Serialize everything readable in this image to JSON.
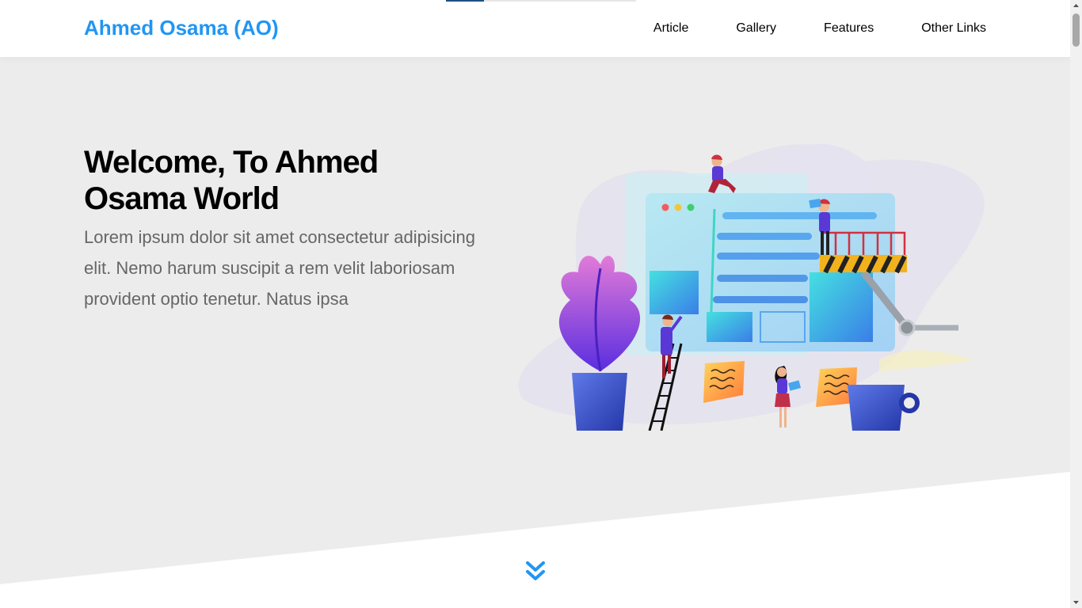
{
  "header": {
    "logo": "Ahmed Osama (AO)",
    "nav": [
      {
        "label": "Article"
      },
      {
        "label": "Gallery"
      },
      {
        "label": "Features"
      },
      {
        "label": "Other Links"
      }
    ],
    "scroll_progress": 0.2
  },
  "landing": {
    "title": "Welcome, To Ahmed Osama World",
    "text": "Lorem ipsum dolor sit amet consectetur adipisicing elit. Nemo harum suscipit a rem velit laboriosam provident optio tenetur. Natus ipsa",
    "illustration": "landing-illustration",
    "go_down_icon": "double-chevron-down-icon"
  },
  "colors": {
    "accent": "#2196f3",
    "landing_bg": "#ececec",
    "text_muted": "#666666",
    "progress": "#1f4f80"
  }
}
